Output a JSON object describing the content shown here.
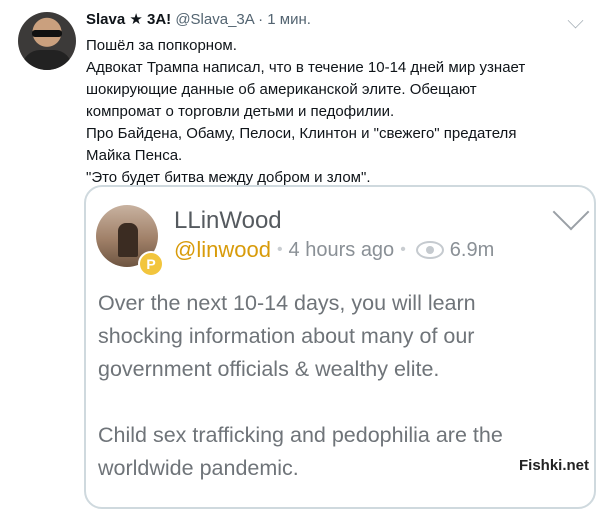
{
  "tweet": {
    "author_name": "Slava ★ 3A!",
    "handle": "@Slava_3A",
    "separator": "·",
    "time": "1 мин.",
    "lines": [
      "Пошёл за попкорном.",
      "Адвокат Трампа написал, что в течение 10-14 дней мир узнает",
      "шокирующие данные об американской элите. Обещают",
      "компромат о торговли детьми и педофилии.",
      "Про Байдена, Обаму, Пелоси, Клинтон и \"свежего\" предателя",
      "Майка Пенса.",
      "\"Это будет битва между добром и злом\"."
    ]
  },
  "quote": {
    "author_name": "LLinWood",
    "handle": "@linwood",
    "separator": "•",
    "time": "4 hours ago",
    "views": "6.9m",
    "badge_letter": "P",
    "paragraph1": [
      "Over the next 10-14 days, you will learn",
      "shocking information about many of our",
      "government officials & wealthy elite."
    ],
    "paragraph2": [
      "Child sex trafficking and pedophilia are the",
      "worldwide pandemic."
    ]
  },
  "watermark": "Fishki.net",
  "icons": {
    "more": "chevron-down-icon",
    "views": "eye-icon",
    "badge": "parler-badge-icon"
  },
  "colors": {
    "handle_accent": "#d89b0a",
    "badge": "#f2c53d",
    "border": "#cfd9de"
  }
}
